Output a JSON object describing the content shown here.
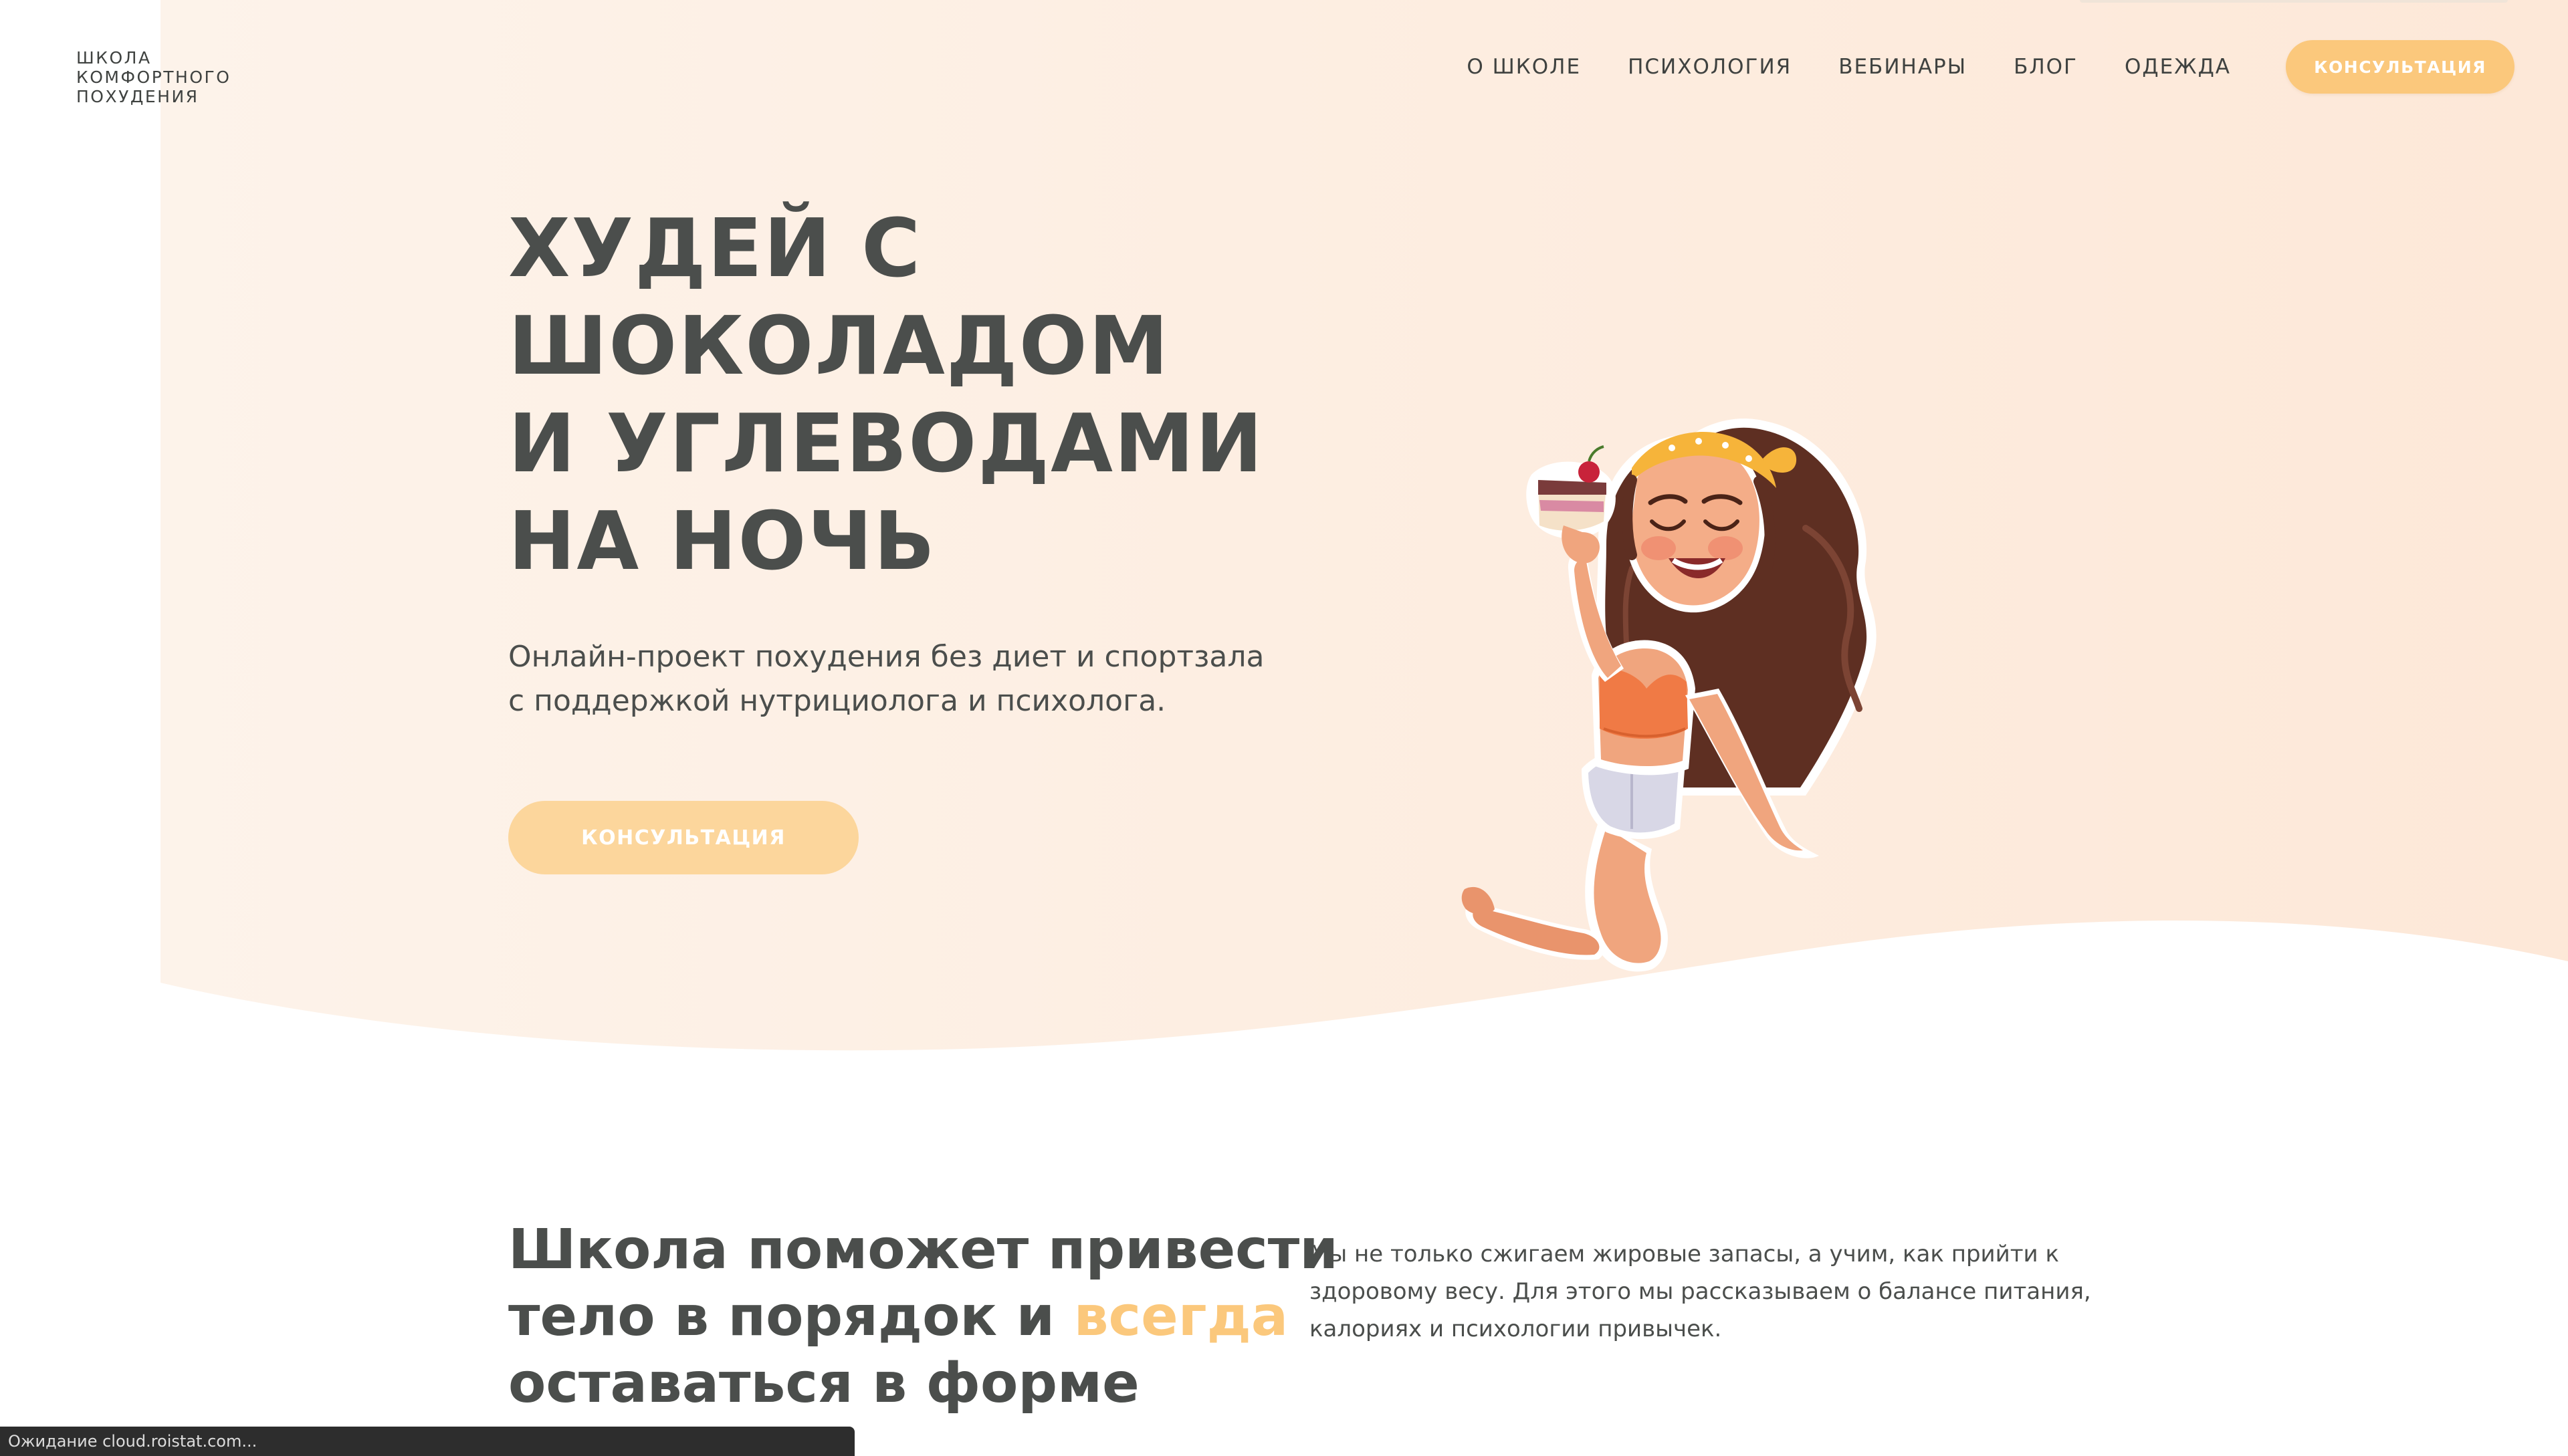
{
  "logo": {
    "line1": "ШКОЛА",
    "line2": "КОМФОРТНОГО",
    "line3": "ПОХУДЕНИЯ"
  },
  "nav": {
    "items": [
      {
        "label": "О ШКОЛЕ"
      },
      {
        "label": "ПСИХОЛОГИЯ"
      },
      {
        "label": "ВЕБИНАРЫ"
      },
      {
        "label": "БЛОГ"
      },
      {
        "label": "ОДЕЖДА"
      }
    ],
    "cta_label": "КОНСУЛЬТАЦИЯ"
  },
  "hero": {
    "title_lines": [
      "ХУДЕЙ С",
      "ШОКОЛАДОМ",
      "И УГЛЕВОДАМИ",
      "НА НОЧЬ"
    ],
    "subtitle_lines": [
      "Онлайн-проект похудения без диет и спортзала",
      "с поддержкой нутрициолога и психолога."
    ],
    "cta_label": "КОНСУЛЬТАЦИЯ"
  },
  "section2": {
    "title_line1": "Школа поможет привести",
    "title_line2_pre": "тело в порядок и ",
    "title_line2_accent": "всегда",
    "title_line3": "оставаться в форме",
    "text_lines": [
      "Мы не только сжигаем жировые запасы, а учим, как прийти к",
      "здоровому весу. Для этого мы рассказываем о балансе питания,",
      "калориях и психологии привычек."
    ]
  },
  "status_bar": {
    "text": "Ожидание cloud.roistat.com..."
  },
  "colors": {
    "accent": "#fbc87c",
    "accent_light": "#fcd69c",
    "hero_bg": "#fdf1e6",
    "text": "#4b4e4c"
  },
  "illustration": {
    "icon": "girl-eating-cake-illustration"
  }
}
